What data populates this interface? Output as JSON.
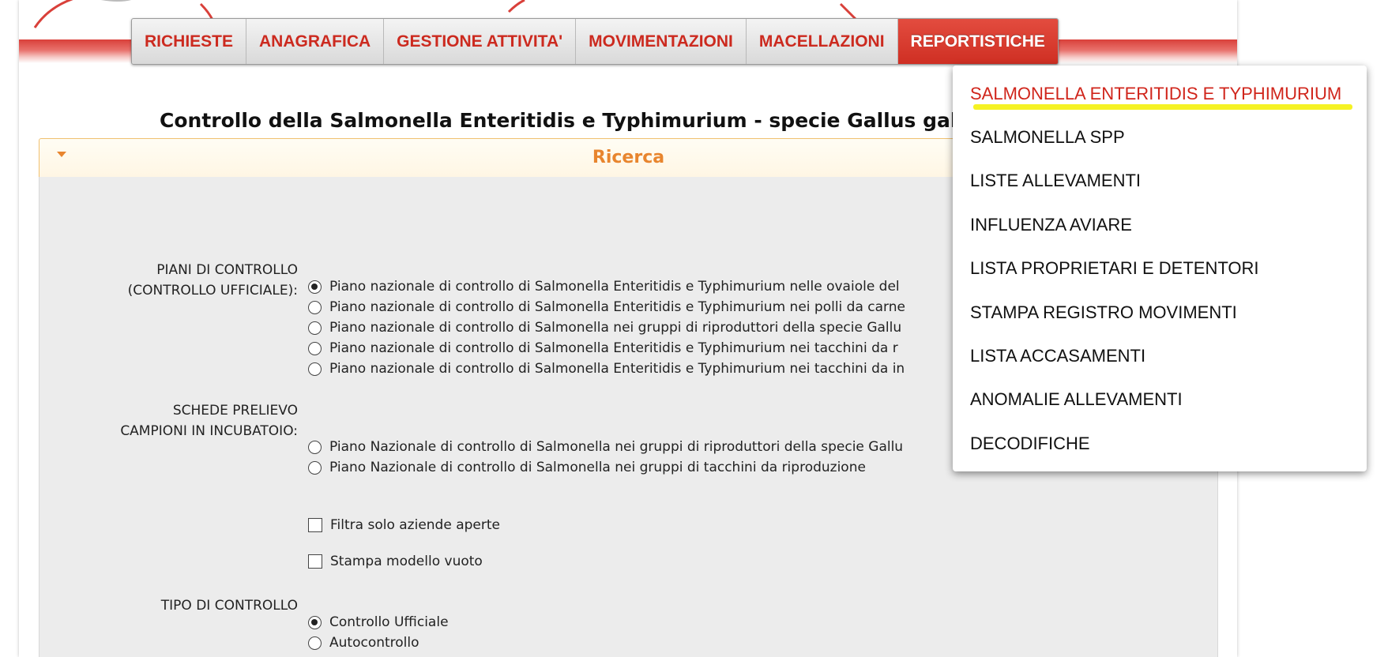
{
  "nav": {
    "items": [
      {
        "label": "RICHIESTE",
        "active": false
      },
      {
        "label": "ANAGRAFICA",
        "active": false
      },
      {
        "label": "GESTIONE ATTIVITA'",
        "active": false
      },
      {
        "label": "MOVIMENTAZIONI",
        "active": false
      },
      {
        "label": "MACELLAZIONI",
        "active": false
      },
      {
        "label": "REPORTISTICHE",
        "active": true
      }
    ]
  },
  "page": {
    "title": "Controllo della Salmonella Enteritidis e Typhimurium - specie Gallus gall"
  },
  "search_panel": {
    "title": "Ricerca",
    "piani": {
      "label_line1": "PIANI DI CONTROLLO",
      "label_line2": "(CONTROLLO UFFICIALE):",
      "options": [
        {
          "text": "Piano nazionale di controllo di Salmonella Enteritidis e Typhimurium nelle ovaiole del",
          "checked": true
        },
        {
          "text": "Piano nazionale di controllo di Salmonella Enteritidis e Typhimurium nei polli da carne",
          "checked": false
        },
        {
          "text": "Piano nazionale di controllo di Salmonella nei gruppi di riproduttori della specie Gallu",
          "checked": false
        },
        {
          "text": "Piano nazionale di controllo di Salmonella Enteritidis e Typhimurium nei tacchini da r",
          "checked": false
        },
        {
          "text": "Piano nazionale di controllo di Salmonella Enteritidis e Typhimurium nei tacchini da in",
          "checked": false
        }
      ]
    },
    "schede": {
      "label_line1": "SCHEDE PRELIEVO",
      "label_line2": "CAMPIONI IN INCUBATOIO:",
      "options": [
        {
          "text": "Piano Nazionale di controllo di Salmonella nei gruppi di riproduttori della specie Gallu",
          "checked": false
        },
        {
          "text": "Piano Nazionale di controllo di Salmonella nei gruppi di tacchini da riproduzione",
          "checked": false
        }
      ]
    },
    "filters": {
      "filtra_label": "Filtra solo aziende aperte",
      "stampa_label": "Stampa modello vuoto"
    },
    "tipo": {
      "label": "TIPO DI CONTROLLO",
      "options": [
        {
          "text": "Controllo Ufficiale",
          "checked": true
        },
        {
          "text": "Autocontrollo",
          "checked": false
        }
      ]
    }
  },
  "dropdown": {
    "items": [
      "SALMONELLA ENTERITIDIS E TYPHIMURIUM",
      "SALMONELLA SPP",
      "LISTE ALLEVAMENTI",
      "INFLUENZA AVIARE",
      "LISTA PROPRIETARI E DETENTORI",
      "STAMPA REGISTRO MOVIMENTI",
      "LISTA ACCASAMENTI",
      "ANOMALIE ALLEVAMENTI",
      "DECODIFICHE"
    ],
    "highlighted_index": 0
  },
  "colors": {
    "brand_red": "#cc2a1f",
    "accent_orange": "#e8852e",
    "highlight_yellow": "#f5f224"
  }
}
